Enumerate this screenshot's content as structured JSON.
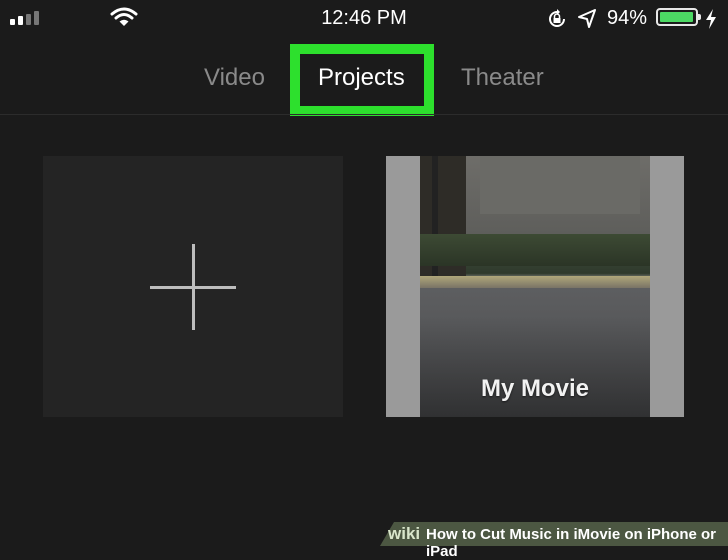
{
  "status_bar": {
    "time": "12:46 PM",
    "battery_percent": "94%",
    "battery_level": 0.94,
    "icons": [
      "signal-icon",
      "wifi-icon",
      "rotation-lock-icon",
      "location-icon",
      "battery-icon",
      "charging-bolt-icon"
    ]
  },
  "tabs": [
    {
      "label": "Video",
      "selected": false
    },
    {
      "label": "Projects",
      "selected": true
    },
    {
      "label": "Theater",
      "selected": false
    }
  ],
  "projects": {
    "new_project_icon": "plus-icon",
    "items": [
      {
        "title": "My Movie"
      }
    ]
  },
  "watermark": {
    "wiki": "wiki",
    "text": "How to Cut Music in iMovie on iPhone or iPad"
  },
  "colors": {
    "background": "#1b1b1b",
    "highlight": "#2de02d",
    "battery": "#4cd964",
    "tab_inactive": "#8a8a8a"
  }
}
